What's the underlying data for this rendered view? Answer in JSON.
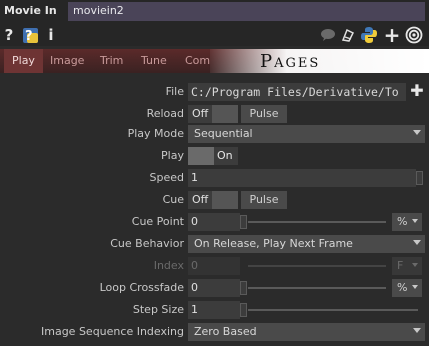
{
  "header": {
    "op_type": "Movie In",
    "op_name": "moviein2"
  },
  "iconbar": {
    "left_icons": [
      "help-icon",
      "python-help-icon",
      "info-icon"
    ],
    "help_glyph": "?",
    "info_glyph": "i",
    "right_icons": [
      "comment-icon",
      "clone-icon",
      "python-icon",
      "add-icon",
      "target-icon"
    ]
  },
  "tabs": [
    {
      "label": "Play",
      "active": true
    },
    {
      "label": "Image",
      "active": false
    },
    {
      "label": "Trim",
      "active": false
    },
    {
      "label": "Tune",
      "active": false
    },
    {
      "label": "Com",
      "active": false
    }
  ],
  "pages_banner": "Pages",
  "params": {
    "file": {
      "label": "File",
      "value": "C:/Program Files/Derivative/To"
    },
    "reload": {
      "label": "Reload",
      "toggle": "Off",
      "pulse": "Pulse"
    },
    "play_mode": {
      "label": "Play Mode",
      "value": "Sequential"
    },
    "play": {
      "label": "Play",
      "toggle": "On"
    },
    "speed": {
      "label": "Speed",
      "value": "1"
    },
    "cue": {
      "label": "Cue",
      "toggle": "Off",
      "pulse": "Pulse"
    },
    "cue_point": {
      "label": "Cue Point",
      "value": "0",
      "unit": "%"
    },
    "cue_behavior": {
      "label": "Cue Behavior",
      "value": "On Release, Play Next Frame"
    },
    "index": {
      "label": "Index",
      "value": "0",
      "unit": "F",
      "disabled": true
    },
    "loop_crossfade": {
      "label": "Loop Crossfade",
      "value": "0",
      "unit": "%"
    },
    "step_size": {
      "label": "Step Size",
      "value": "1"
    },
    "image_seq_indexing": {
      "label": "Image Sequence Indexing",
      "value": "Zero Based"
    }
  },
  "colors": {
    "background": "#2b2b2b",
    "name_field": "#4a4458",
    "tab_bar": "#5b2a2a",
    "active_tab": "#6e3434"
  }
}
